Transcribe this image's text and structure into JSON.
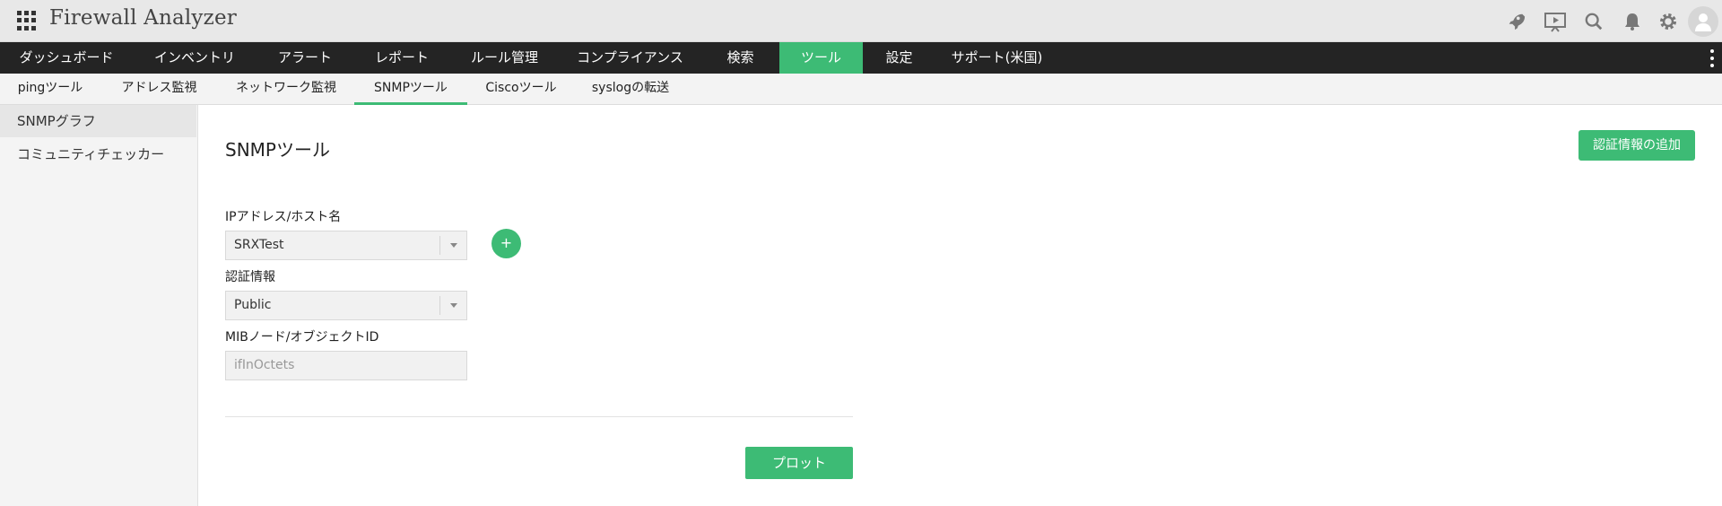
{
  "app": {
    "title": "Firewall Analyzer"
  },
  "header_icons": [
    "rocket-icon",
    "presentation-play-icon",
    "search-icon",
    "bell-icon",
    "gear-icon",
    "user-avatar-icon"
  ],
  "main_nav": {
    "items": [
      {
        "label": "ダッシュボード"
      },
      {
        "label": "インベントリ"
      },
      {
        "label": "アラート"
      },
      {
        "label": "レポート"
      },
      {
        "label": "ルール管理"
      },
      {
        "label": "コンプライアンス"
      },
      {
        "label": "検索"
      },
      {
        "label": "ツール"
      },
      {
        "label": "設定"
      },
      {
        "label": "サポート(米国)"
      }
    ],
    "active": "ツール"
  },
  "sub_nav": {
    "items": [
      {
        "label": "pingツール"
      },
      {
        "label": "アドレス監視"
      },
      {
        "label": "ネットワーク監視"
      },
      {
        "label": "SNMPツール"
      },
      {
        "label": "Ciscoツール"
      },
      {
        "label": "syslogの転送"
      }
    ],
    "active": "SNMPツール"
  },
  "sidebar": {
    "items": [
      {
        "label": "SNMPグラフ"
      },
      {
        "label": "コミュニティチェッカー"
      }
    ],
    "active": "SNMPグラフ"
  },
  "page": {
    "title": "SNMPツール",
    "add_credential_label": "認証情報の追加"
  },
  "form": {
    "host_label": "IPアドレス/ホスト名",
    "host_value": "SRXTest",
    "add_host_symbol": "+",
    "credential_label": "認証情報",
    "credential_value": "Public",
    "oid_label": "MIBノード/オブジェクトID",
    "oid_placeholder": "ifInOctets",
    "plot_label": "プロット"
  },
  "colors": {
    "accent": "#3dbb75",
    "nav_bg": "#242424",
    "header_bg": "#e8e8e8"
  }
}
